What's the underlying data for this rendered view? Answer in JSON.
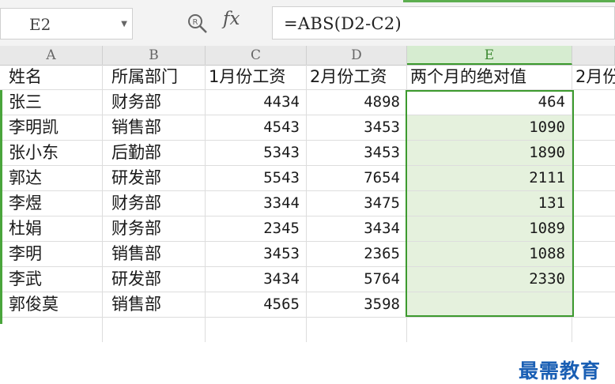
{
  "formula_bar": {
    "cell_ref": "E2",
    "formula": "=ABS(D2-C2)",
    "fx_label": "fx"
  },
  "columns": [
    "A",
    "B",
    "C",
    "D",
    "E",
    ""
  ],
  "active_column": "E",
  "headers": [
    "姓名",
    "所属部门",
    "1月份工资",
    "2月份工资",
    "两个月的绝对值",
    "2月份"
  ],
  "rows": [
    {
      "name": "张三",
      "dept": "财务部",
      "jan": "4434",
      "feb": "4898",
      "abs": "464"
    },
    {
      "name": "李明凯",
      "dept": "销售部",
      "jan": "4543",
      "feb": "3453",
      "abs": "1090"
    },
    {
      "name": "张小东",
      "dept": "后勤部",
      "jan": "5343",
      "feb": "3453",
      "abs": "1890"
    },
    {
      "name": "郭达",
      "dept": "研发部",
      "jan": "5543",
      "feb": "7654",
      "abs": "2111"
    },
    {
      "name": "李煜",
      "dept": "财务部",
      "jan": "3344",
      "feb": "3475",
      "abs": "131"
    },
    {
      "name": "杜娟",
      "dept": "财务部",
      "jan": "2345",
      "feb": "3434",
      "abs": "1089"
    },
    {
      "name": "李明",
      "dept": "销售部",
      "jan": "3453",
      "feb": "2365",
      "abs": "1088"
    },
    {
      "name": "李武",
      "dept": "研发部",
      "jan": "3434",
      "feb": "5764",
      "abs": "2330"
    },
    {
      "name": "郭俊莫",
      "dept": "销售部",
      "jan": "4565",
      "feb": "3598",
      "abs": ""
    }
  ],
  "watermark": "最需教育",
  "colors": {
    "accent": "#3c9a2e",
    "selection_fill": "#e5f1dd",
    "watermark": "#1a5fb4"
  },
  "icons": [
    "dropdown-arrow-icon",
    "zoom-icon",
    "fx-icon"
  ]
}
